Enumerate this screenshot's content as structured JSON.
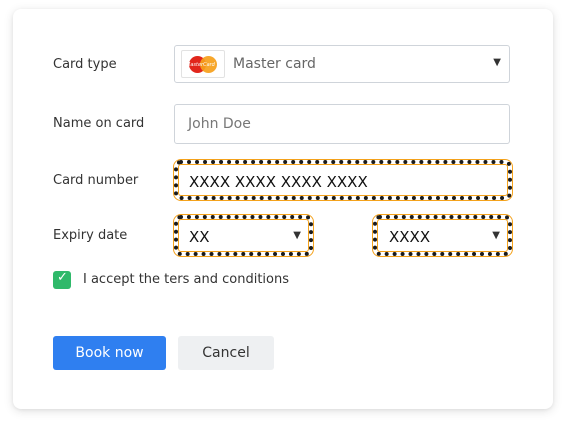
{
  "form": {
    "card_type_label": "Card type",
    "card_type_value": "Master card",
    "card_type_logo_text": "MasterCard",
    "name_label": "Name on card",
    "name_placeholder": "John Doe",
    "card_number_label": "Card number",
    "card_number_placeholder": "XXXX XXXX XXXX XXXX",
    "expiry_label": "Expiry date",
    "expiry_month_value": "XX",
    "expiry_year_value": "XXXX",
    "accept_label": "I accept the ters and conditions",
    "accept_checked": true
  },
  "buttons": {
    "book_now": "Book now",
    "cancel": "Cancel"
  },
  "colors": {
    "primary": "#2f7ff0",
    "checkbox": "#2fb96a",
    "highlight": "#f4a21c"
  },
  "icons": {
    "dropdown": "chevron-down-icon",
    "checkbox": "check-icon",
    "card_logo": "mastercard-logo-icon"
  }
}
